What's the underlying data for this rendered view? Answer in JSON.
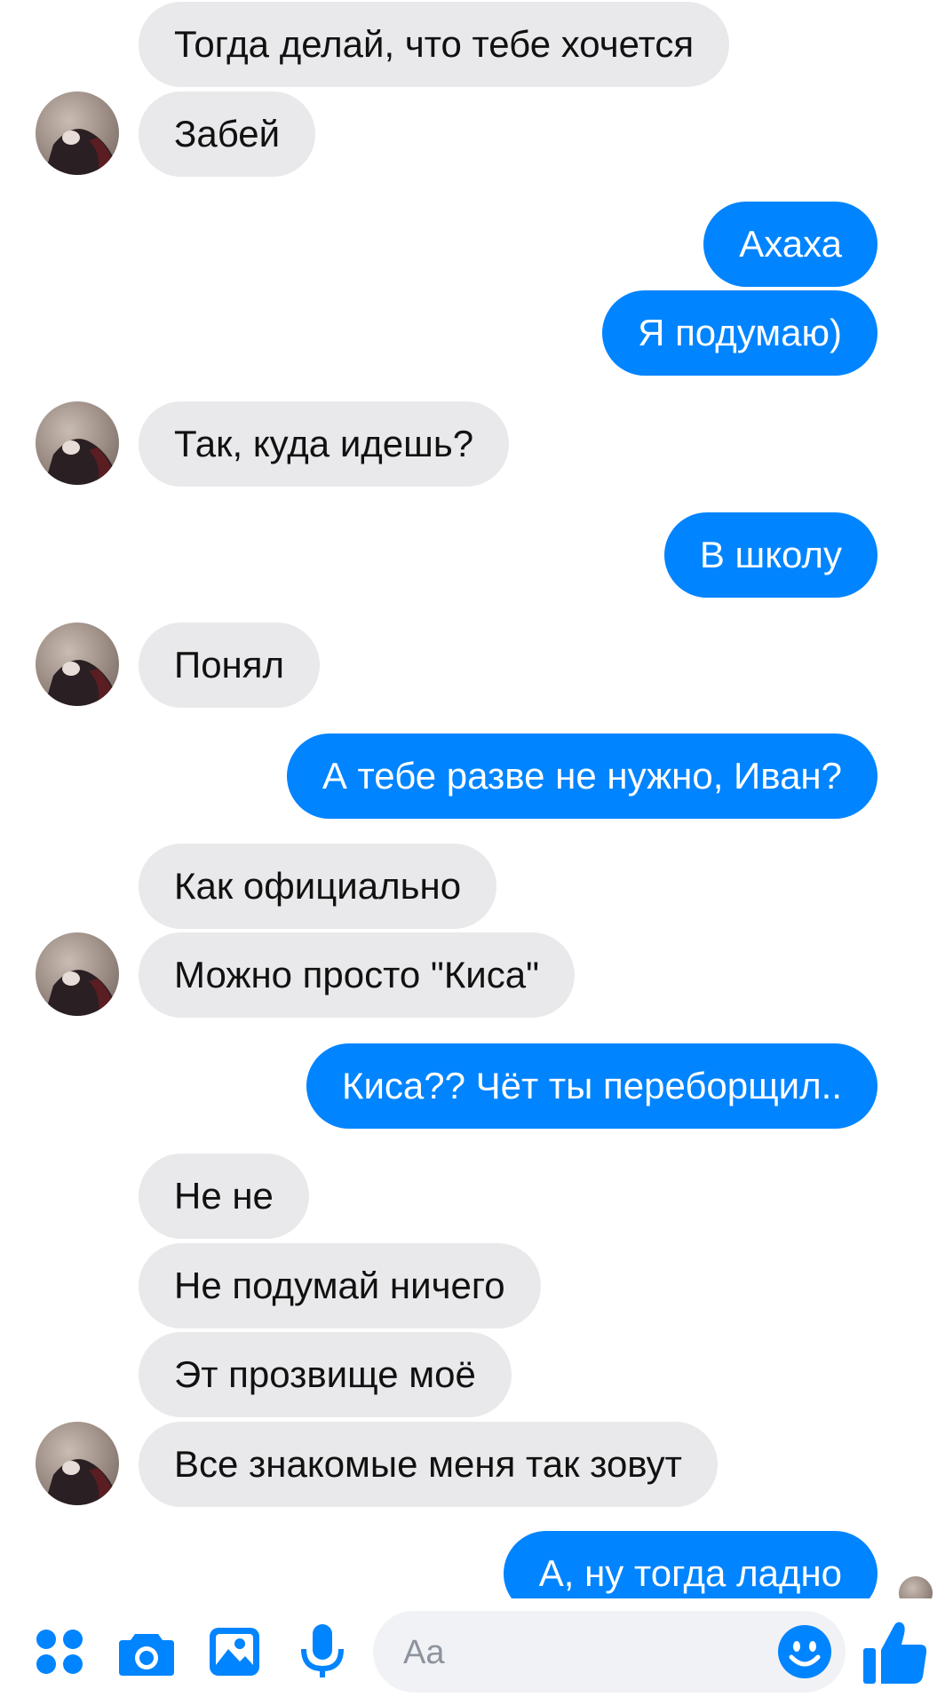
{
  "colors": {
    "outgoing": "#0084ff",
    "incoming": "#e9e9eb",
    "accent": "#0084ff"
  },
  "messages": [
    {
      "dir": "in",
      "text": "Тогда делай, что тебе хочется"
    },
    {
      "dir": "in",
      "text": "Забей",
      "avatar": true
    },
    {
      "dir": "out",
      "text": "Ахаха"
    },
    {
      "dir": "out",
      "text": "Я подумаю)"
    },
    {
      "dir": "in",
      "text": "Так, куда идешь?",
      "avatar": true
    },
    {
      "dir": "out",
      "text": "В школу"
    },
    {
      "dir": "in",
      "text": "Понял",
      "avatar": true
    },
    {
      "dir": "out",
      "text": "А тебе разве не нужно, Иван?"
    },
    {
      "dir": "in",
      "text": "Как официально"
    },
    {
      "dir": "in",
      "text": "Можно просто \"Киса\"",
      "avatar": true
    },
    {
      "dir": "out",
      "text": "Киса?? Чёт ты переборщил.."
    },
    {
      "dir": "in",
      "text": "Не не"
    },
    {
      "dir": "in",
      "text": "Не подумай ничего"
    },
    {
      "dir": "in",
      "text": "Эт прозвище моё"
    },
    {
      "dir": "in",
      "text": "Все знакомые меня так зовут",
      "avatar": true
    },
    {
      "dir": "out",
      "text": "А, ну тогда ладно"
    }
  ],
  "composer": {
    "placeholder": "Aa",
    "icons": [
      "apps-icon",
      "camera-icon",
      "gallery-icon",
      "microphone-icon",
      "emoji-icon",
      "like-icon"
    ]
  }
}
